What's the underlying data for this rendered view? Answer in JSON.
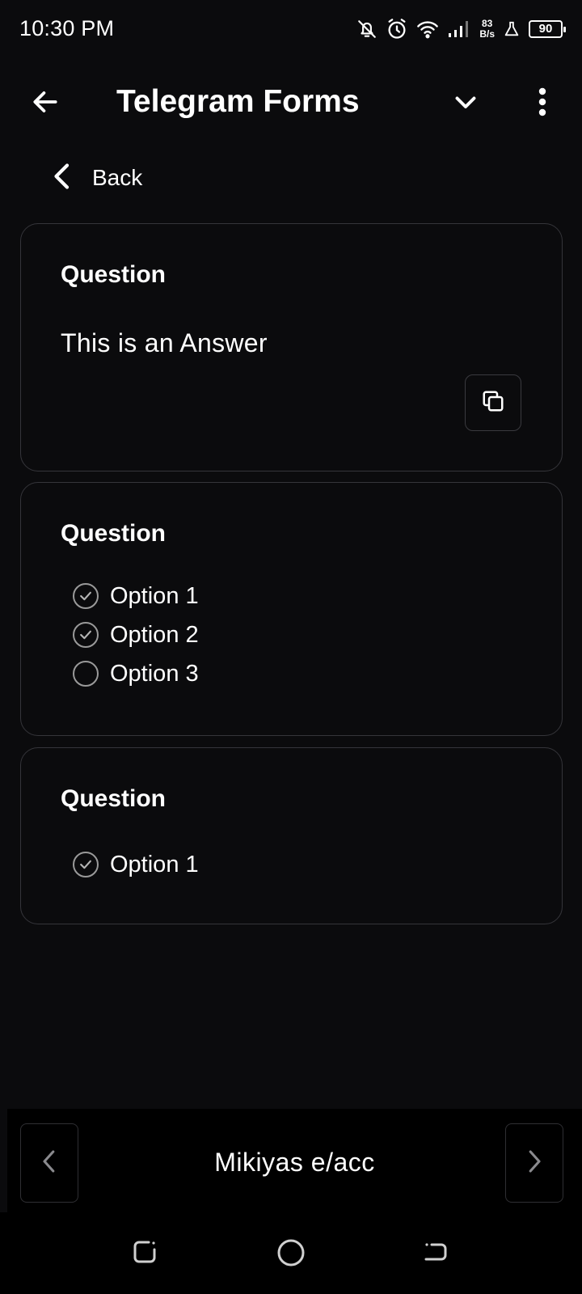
{
  "status_bar": {
    "time": "10:30 PM",
    "net_speed_value": "83",
    "net_speed_unit": "B/s",
    "battery": "90"
  },
  "app_bar": {
    "title": "Telegram Forms"
  },
  "back": {
    "label": "Back"
  },
  "cards": [
    {
      "title": "Question",
      "answer": "This is an Answer"
    },
    {
      "title": "Question",
      "options": [
        {
          "label": "Option 1",
          "checked": true
        },
        {
          "label": "Option 2",
          "checked": true
        },
        {
          "label": "Option 3",
          "checked": false
        }
      ]
    },
    {
      "title": "Question",
      "options": [
        {
          "label": "Option 1",
          "checked": true
        }
      ]
    }
  ],
  "bottom_bar": {
    "name": "Mikiyas e/acc"
  },
  "colors": {
    "background": "#0b0b0d",
    "card_border": "#35353a",
    "text": "#ffffff",
    "radio_border": "#9a9a9a"
  }
}
